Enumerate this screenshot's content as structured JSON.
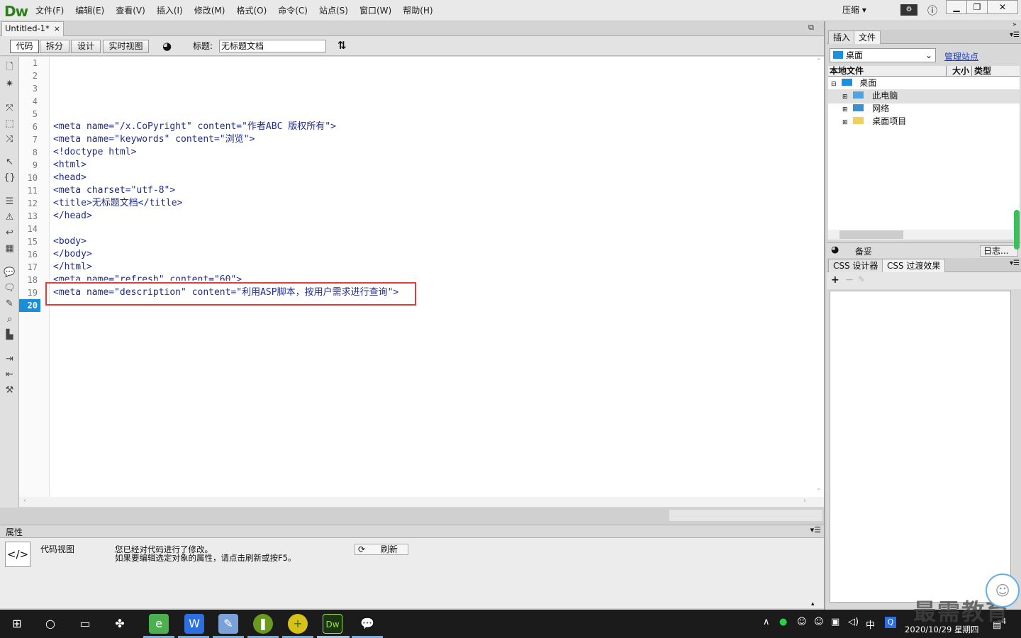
{
  "app": {
    "logo": "Dw",
    "compress_label": "压缩"
  },
  "menu": [
    "文件(F)",
    "编辑(E)",
    "查看(V)",
    "插入(I)",
    "修改(M)",
    "格式(O)",
    "命令(C)",
    "站点(S)",
    "窗口(W)",
    "帮助(H)"
  ],
  "document": {
    "tab": "Untitled-1*",
    "close": "×"
  },
  "toolbar": {
    "code": "代码",
    "split": "拆分",
    "design": "设计",
    "live": "实时视图",
    "title_label": "标题:",
    "title_value": "无标题文档"
  },
  "editor": {
    "line_numbers": [
      "1",
      "2",
      "3",
      "4",
      "5",
      "6",
      "7",
      "8",
      "9",
      "10",
      "11",
      "12",
      "13",
      "14",
      "15",
      "16",
      "17",
      "18",
      "19",
      "20"
    ],
    "current_line": "20",
    "lines": [
      "",
      "",
      "",
      "",
      "",
      "<meta name=\"/x.CoPyright\" content=\"作者ABC 版权所有\">",
      "<meta name=\"keywords\" content=\"浏览\">",
      "<!doctype html>",
      "<html>",
      "<head>",
      "<meta charset=\"utf-8\">",
      "<title>无标题文档</title>",
      "</head>",
      "",
      "<body>",
      "</body>",
      "</html>",
      "<meta name=\"refresh\" content=\"60\">",
      "<meta name=\"description\" content=\"利用ASP脚本，按用户需求进行查询\">",
      ""
    ]
  },
  "properties": {
    "title": "属性",
    "view_label": "代码视图",
    "message_line1": "您已经对代码进行了修改。",
    "message_line2": "如果要编辑选定对象的属性，请点击刷新或按F5。",
    "refresh": "刷新"
  },
  "files_panel": {
    "tab_insert": "插入",
    "tab_files": "文件",
    "site": "桌面",
    "manage_sites": "管理站点",
    "col_local": "本地文件",
    "col_size": "大小",
    "col_type": "类型",
    "tree": [
      {
        "label": "桌面",
        "level": 0
      },
      {
        "label": "此电脑",
        "level": 1
      },
      {
        "label": "网络",
        "level": 1
      },
      {
        "label": "桌面项目",
        "level": 1
      }
    ],
    "status_ready": "备妥",
    "log": "日志..."
  },
  "css_panel": {
    "tab_designer": "CSS 设计器",
    "tab_transitions": "CSS 过渡效果"
  },
  "taskbar": {
    "ime": "中",
    "datetime": "2020/10/29 星期四",
    "notif_count": "4"
  },
  "watermark": "最需教育",
  "colors": {
    "highlight_border": "#e23b3b",
    "current_line": "#1a8fd8",
    "link": "#1e3cc8"
  }
}
